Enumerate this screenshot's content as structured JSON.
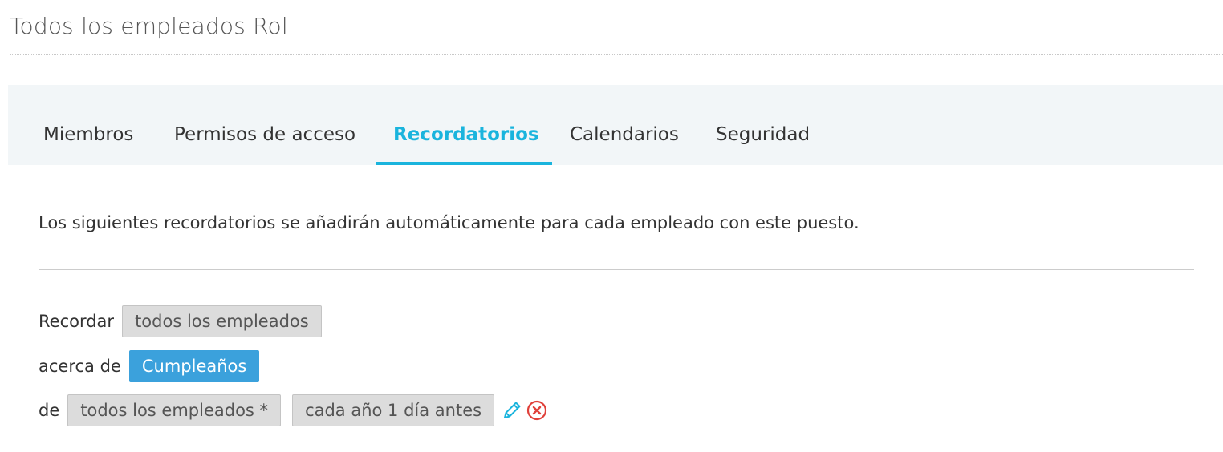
{
  "header": {
    "title": "Todos los empleados Rol"
  },
  "tabs": [
    {
      "label": "Miembros",
      "active": false
    },
    {
      "label": "Permisos de acceso",
      "active": false
    },
    {
      "label": "Recordatorios",
      "active": true
    },
    {
      "label": "Calendarios",
      "active": false
    },
    {
      "label": "Seguridad",
      "active": false
    }
  ],
  "intro_text": "Los siguientes recordatorios se añadirán automáticamente para cada empleado con este puesto.",
  "reminder": {
    "remind_label": "Recordar",
    "remind_value": "todos los empleados",
    "about_label": "acerca de",
    "about_value": "Cumpleaños",
    "of_label": "de",
    "of_value": "todos los empleados *",
    "schedule_value": "cada año 1 día antes",
    "edit_icon": "pencil-icon",
    "delete_icon": "close-circle-icon"
  },
  "colors": {
    "accent": "#1ab4dd",
    "chip_blue": "#3ba1dc",
    "delete_red": "#e0403a"
  }
}
